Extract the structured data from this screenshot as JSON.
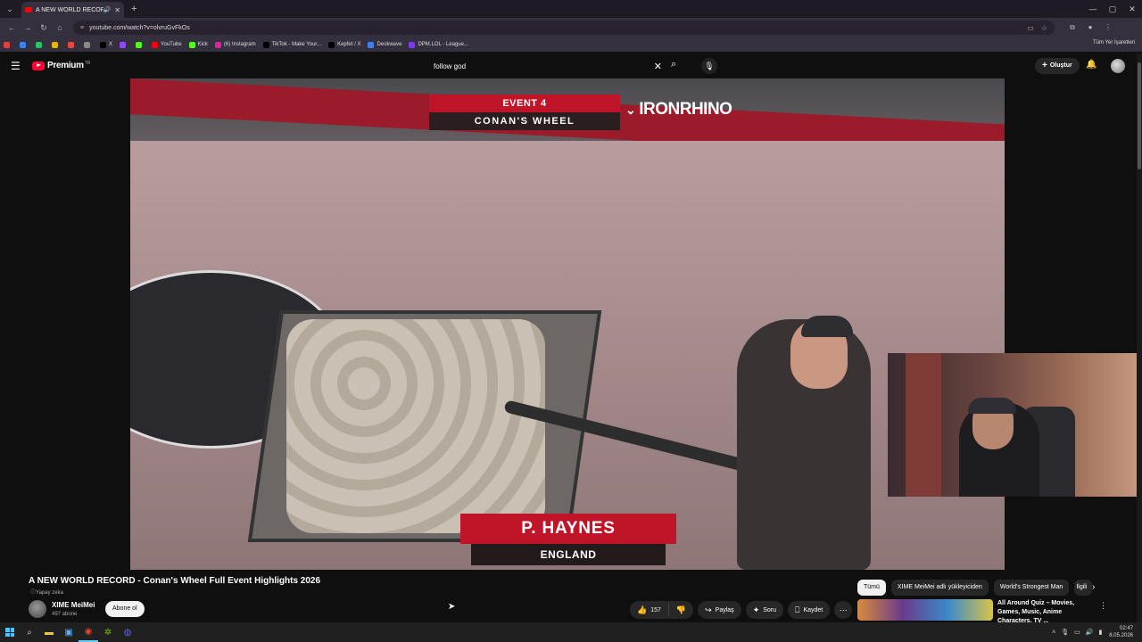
{
  "browser": {
    "tab_title": "A NEW WORLD RECORD -",
    "url": "youtube.com/watch?v=olvruGvFkOs",
    "bookmarks": [
      {
        "label": "",
        "color": "#e04040"
      },
      {
        "label": "",
        "color": "#3b82f6"
      },
      {
        "label": "",
        "color": "#22c55e"
      },
      {
        "label": "",
        "color": "#eab308"
      },
      {
        "label": "",
        "color": "#ef4444"
      },
      {
        "label": "",
        "color": "#888888"
      },
      {
        "label": "X",
        "color": "#000000"
      },
      {
        "label": "",
        "color": "#9146ff"
      },
      {
        "label": "",
        "color": "#53fc18"
      },
      {
        "label": "YouTube",
        "color": "#ff0000"
      },
      {
        "label": "Kick",
        "color": "#53fc18"
      },
      {
        "label": "(6) Instagram",
        "color": "#d6249f"
      },
      {
        "label": "TikTok - Make Your...",
        "color": "#000000"
      },
      {
        "label": "Kepfet / X",
        "color": "#000000"
      },
      {
        "label": "Deokwave",
        "color": "#3b82f6"
      },
      {
        "label": "DPM.LOL - League...",
        "color": "#7c3aed"
      }
    ],
    "all_bookmarks": "Tüm Yer İşaretleri"
  },
  "header": {
    "logo_text": "Premium",
    "region": "TR",
    "search_value": "follow god",
    "create_label": "Oluştur"
  },
  "video": {
    "event_label": "EVENT 4",
    "event_name": "CONAN'S WHEEL",
    "brand": "IRONRHINO",
    "athlete_name": "P. HAYNES",
    "athlete_country": "ENGLAND"
  },
  "info": {
    "title": "A NEW WORLD RECORD - Conan's Wheel Full Event Highlights 2026",
    "ai_label": "Yapay zeka",
    "channel_name": "XIME MeiMei",
    "subscribers": "497 abone",
    "subscribe_label": "Abone ol",
    "likes": "157",
    "share_label": "Paylaş",
    "ask_label": "Soru",
    "save_label": "Kaydet"
  },
  "sidebar": {
    "chips": [
      "Tümü",
      "XIME MeiMei adlı yükleyiciden",
      "World's Strongest Man",
      "İlgili"
    ],
    "rec_title": "All Around Quiz – Movies, Games, Music, Anime Characters, TV ..."
  },
  "taskbar": {
    "time": "02:47",
    "date": "8.05.2026"
  }
}
